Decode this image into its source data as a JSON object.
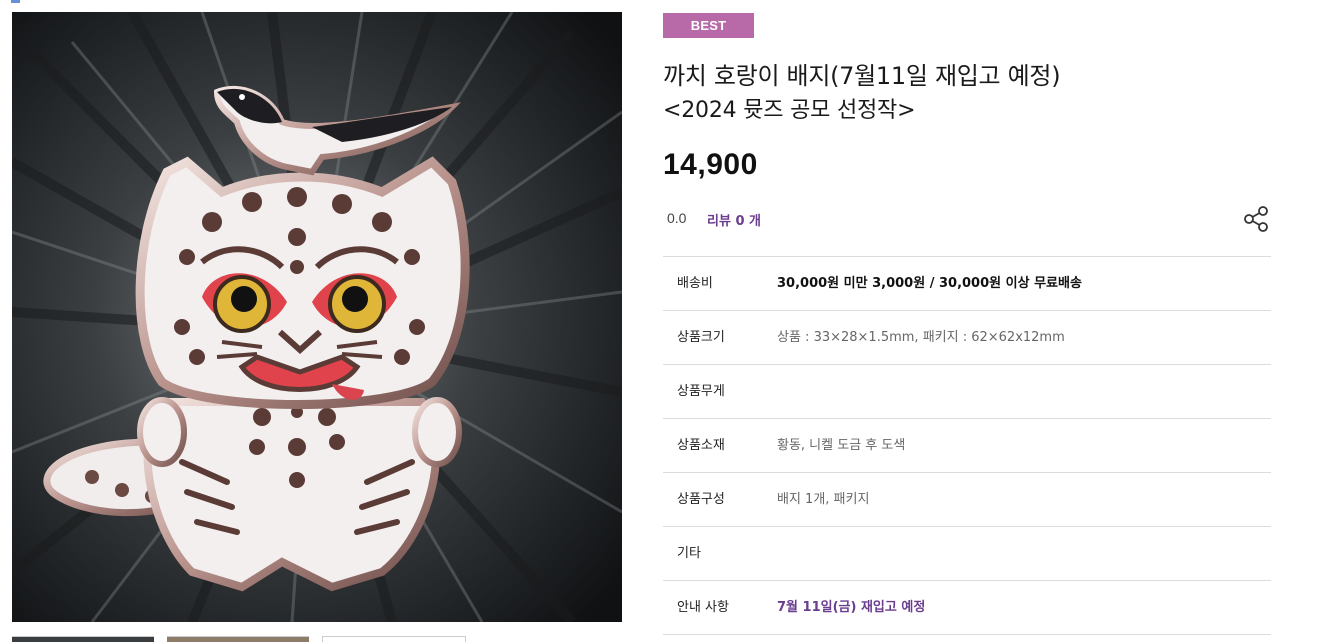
{
  "product": {
    "badge": "BEST",
    "title": "까치 호랑이 배지(7월11일 재입고 예정)",
    "subtitle": "<2024 뮷즈 공모 선정작>",
    "price": "14,900",
    "rating": "0.0",
    "review_label": "리뷰 0 개",
    "share_icon": "share-icon",
    "accent_color": "#b86aa8",
    "link_color": "#6a3d8f"
  },
  "specs": [
    {
      "label": "배송비",
      "value": "30,000원 미만 3,000원 / 30,000원 이상 무료배송"
    },
    {
      "label": "상품크기",
      "value": "상품 : 33×28×1.5mm, 패키지 : 62×62x12mm"
    },
    {
      "label": "상품무게",
      "value": ""
    },
    {
      "label": "상품소재",
      "value": "황동, 니켈 도금 후 도색"
    },
    {
      "label": "상품구성",
      "value": "배지 1개, 패키지"
    },
    {
      "label": "기타",
      "value": ""
    },
    {
      "label": "안내 사항",
      "value": "7월 11일(금) 재입고 예정"
    }
  ]
}
